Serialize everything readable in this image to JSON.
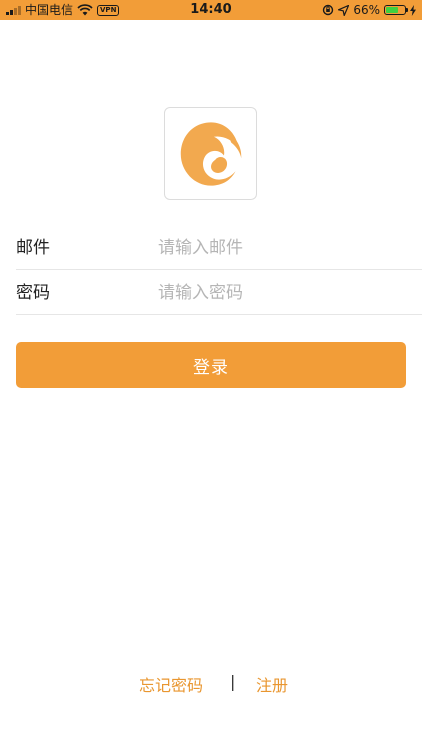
{
  "status_bar": {
    "carrier": "中国电信",
    "vpn": "VPN",
    "time": "14:40",
    "battery_percent": "66%",
    "battery_level": 0.66
  },
  "login": {
    "email_label": "邮件",
    "email_placeholder": "请输入邮件",
    "password_label": "密码",
    "password_placeholder": "请输入密码",
    "login_button": "登录"
  },
  "footer": {
    "forgot_password": "忘记密码",
    "divider": "|",
    "register": "注册"
  },
  "colors": {
    "accent": "#f29d38",
    "link": "#e9962f"
  }
}
